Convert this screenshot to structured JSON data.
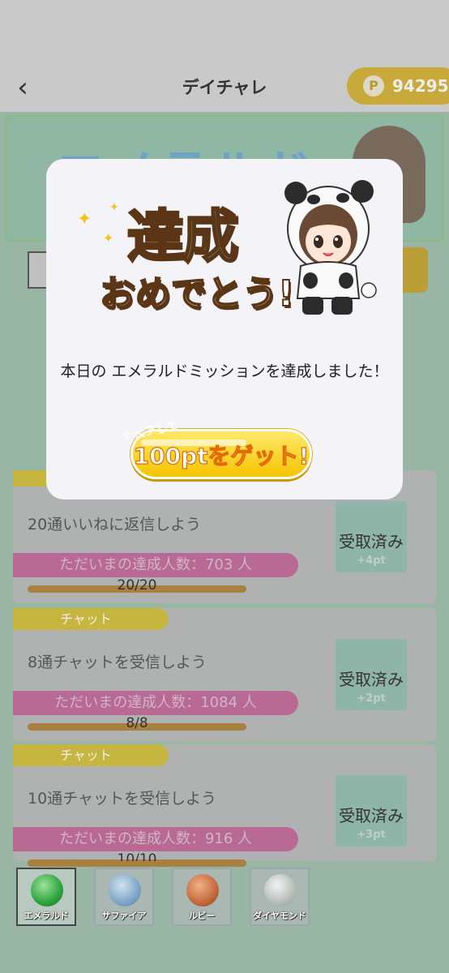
{
  "header": {
    "back_icon": "chevron-left-icon",
    "title": "デイチャレ",
    "points": {
      "icon": "P",
      "value": "94295"
    }
  },
  "banner": {
    "text": "エメラルド"
  },
  "missions": [
    {
      "category": "",
      "title": "20通いいねに返信しよう",
      "achievers": "ただいまの達成人数：703 人",
      "progress_text": "20/20",
      "progress": 1.0,
      "claim_label": "受取済み",
      "reward": "+4pt"
    },
    {
      "category": "チャット",
      "title": "8通チャットを受信しよう",
      "achievers": "ただいまの達成人数：1084 人",
      "progress_text": "8/8",
      "progress": 1.0,
      "claim_label": "受取済み",
      "reward": "+2pt"
    },
    {
      "category": "チャット",
      "title": "10通チャットを受信しよう",
      "achievers": "ただいまの達成人数：916 人",
      "progress_text": "10/10",
      "progress": 1.0,
      "claim_label": "受取済み",
      "reward": "+3pt"
    }
  ],
  "gem_tabs": [
    {
      "label": "エメラルド",
      "color": "#2fa33d",
      "active": true
    },
    {
      "label": "サファイア",
      "color": "#7ea6c7",
      "active": false
    },
    {
      "label": "ルビー",
      "color": "#c46a3a",
      "active": false
    },
    {
      "label": "ダイヤモンド",
      "color": "#b5bdb9",
      "active": false
    }
  ],
  "modal": {
    "title_line1": "達成",
    "title_line2": "おめでとう!",
    "message": "本日の エメラルドミッションを達成しました！",
    "share_small": "シェアして",
    "share_main": "100ptをゲット!"
  }
}
